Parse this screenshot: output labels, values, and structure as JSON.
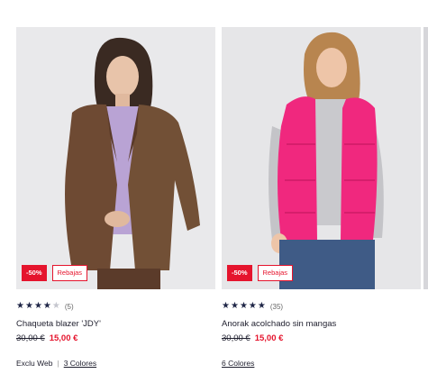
{
  "products": [
    {
      "discount_badge": "-50%",
      "sale_badge": "Rebajas",
      "rating": 4,
      "review_count": "(5)",
      "title": "Chaqueta blazer 'JDY'",
      "old_price": "30,00 €",
      "new_price": "15,00 €",
      "tag": "Exclu Web",
      "colors_link": "3 Colores",
      "image_icon": "woman-brown-blazer-photo"
    },
    {
      "discount_badge": "-50%",
      "sale_badge": "Rebajas",
      "rating": 5,
      "review_count": "(35)",
      "title": "Anorak acolchado sin mangas",
      "old_price": "30,00 €",
      "new_price": "15,00 €",
      "colors_link": "6 Colores",
      "image_icon": "woman-pink-puffer-vest-photo"
    }
  ],
  "colors": {
    "accent_red": "#e5142d",
    "star_navy": "#1f2647",
    "text": "#1f1f2e"
  }
}
